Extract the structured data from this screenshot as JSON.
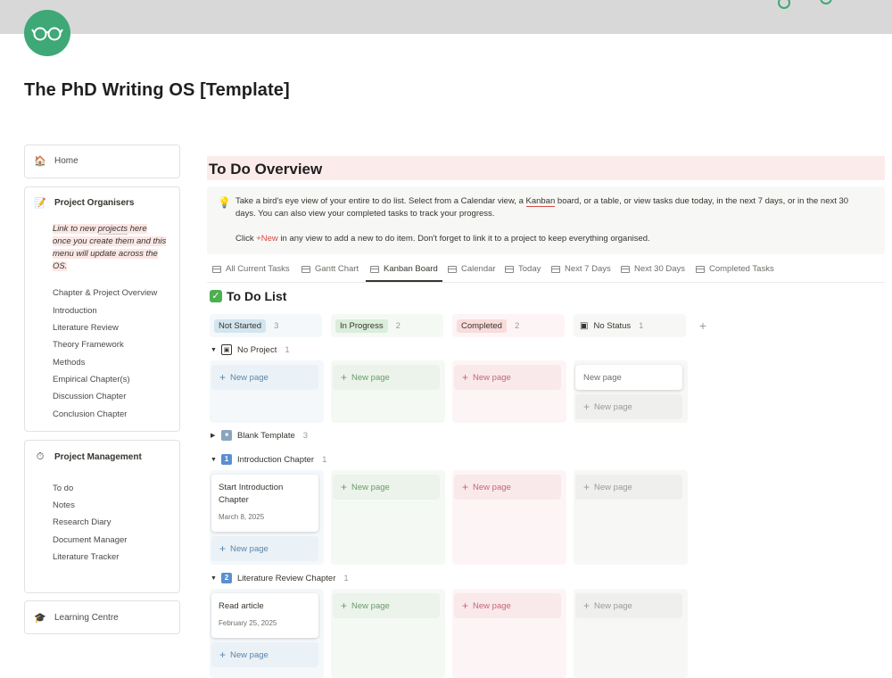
{
  "page": {
    "title": "The PhD Writing OS [Template]",
    "icon": "glasses-icon"
  },
  "sidebar": {
    "home": {
      "emoji": "🏠",
      "label": "Home"
    },
    "organisers": {
      "emoji": "📝",
      "label": "Project Organisers",
      "note_pre": "Link to new ",
      "note_hl": "projects",
      "note_post": " here once you create them and this menu will update across the OS.",
      "links": [
        "Chapter & Project Overview",
        "Introduction",
        "Literature Review",
        "Theory Framework",
        "Methods",
        "Empirical Chapter(s)",
        "Discussion Chapter",
        "Conclusion Chapter"
      ]
    },
    "management": {
      "emoji": "⏱",
      "label": "Project Management",
      "links": [
        "To do",
        "Notes",
        "Research Diary",
        "Document Manager",
        "Literature Tracker"
      ]
    },
    "learning": {
      "emoji": "🎓",
      "label": "Learning Centre"
    }
  },
  "overview": {
    "title": "To Do Overview",
    "callout_icon": "💡",
    "line1_a": "Take a bird's eye view of your entire to do list. Select from a Calendar view, a ",
    "line1_b": "Kanban",
    "line1_c": " board, or a table, or view tasks due today, in the next 7 days, or in the next 30",
    "line2": "days. You can also view your completed tasks to track your progress.",
    "line3_a": "Click ",
    "line3_new": "+New",
    "line3_b": " in any view to add a new to do item. Don't forget to link it to a project to keep everything organised."
  },
  "tabs": [
    "All Current Tasks",
    "Gantt Chart",
    "Kanban Board",
    "Calendar",
    "Today",
    "Next 7 Days",
    "Next 30 Days",
    "Completed Tasks"
  ],
  "active_tab": "Kanban Board",
  "board": {
    "title_icon": "✓",
    "title": "To Do List",
    "columns": [
      {
        "label": "Not Started",
        "count": "3",
        "pill_color": "#d3e5ef",
        "bg": "#f4f8fb"
      },
      {
        "label": "In Progress",
        "count": "2",
        "pill_color": "#dbeddb",
        "bg": "#f5f9f4"
      },
      {
        "label": "Completed",
        "count": "2",
        "pill_color": "#f9dcdc",
        "bg": "#fdf5f5"
      },
      {
        "label": "No Status",
        "count": "1",
        "pill_color": "",
        "bg": "#f7f7f5"
      }
    ],
    "add_column": "+",
    "new_page": "New page",
    "groups": [
      {
        "caret": "▼",
        "icon_label": "▣",
        "name": "No Project",
        "count": "1"
      },
      {
        "caret": "▶",
        "icon_label": "■",
        "name": "Blank Template",
        "count": "3"
      },
      {
        "caret": "▼",
        "icon_label": "1",
        "name": "Introduction Chapter",
        "count": "1"
      },
      {
        "caret": "▼",
        "icon_label": "2",
        "name": "Literature Review Chapter",
        "count": "1"
      }
    ],
    "cards": [
      {
        "title": "Start Introduction Chapter",
        "date": "March 8, 2025"
      },
      {
        "title": "Read article",
        "date": "February 25, 2025"
      }
    ]
  },
  "colors": {
    "accent_green": "#3ea877",
    "not_started_text": "#5d86a8",
    "in_progress_text": "#6a9b6a",
    "completed_text": "#c2667a",
    "no_status_text": "#9b9a97"
  }
}
